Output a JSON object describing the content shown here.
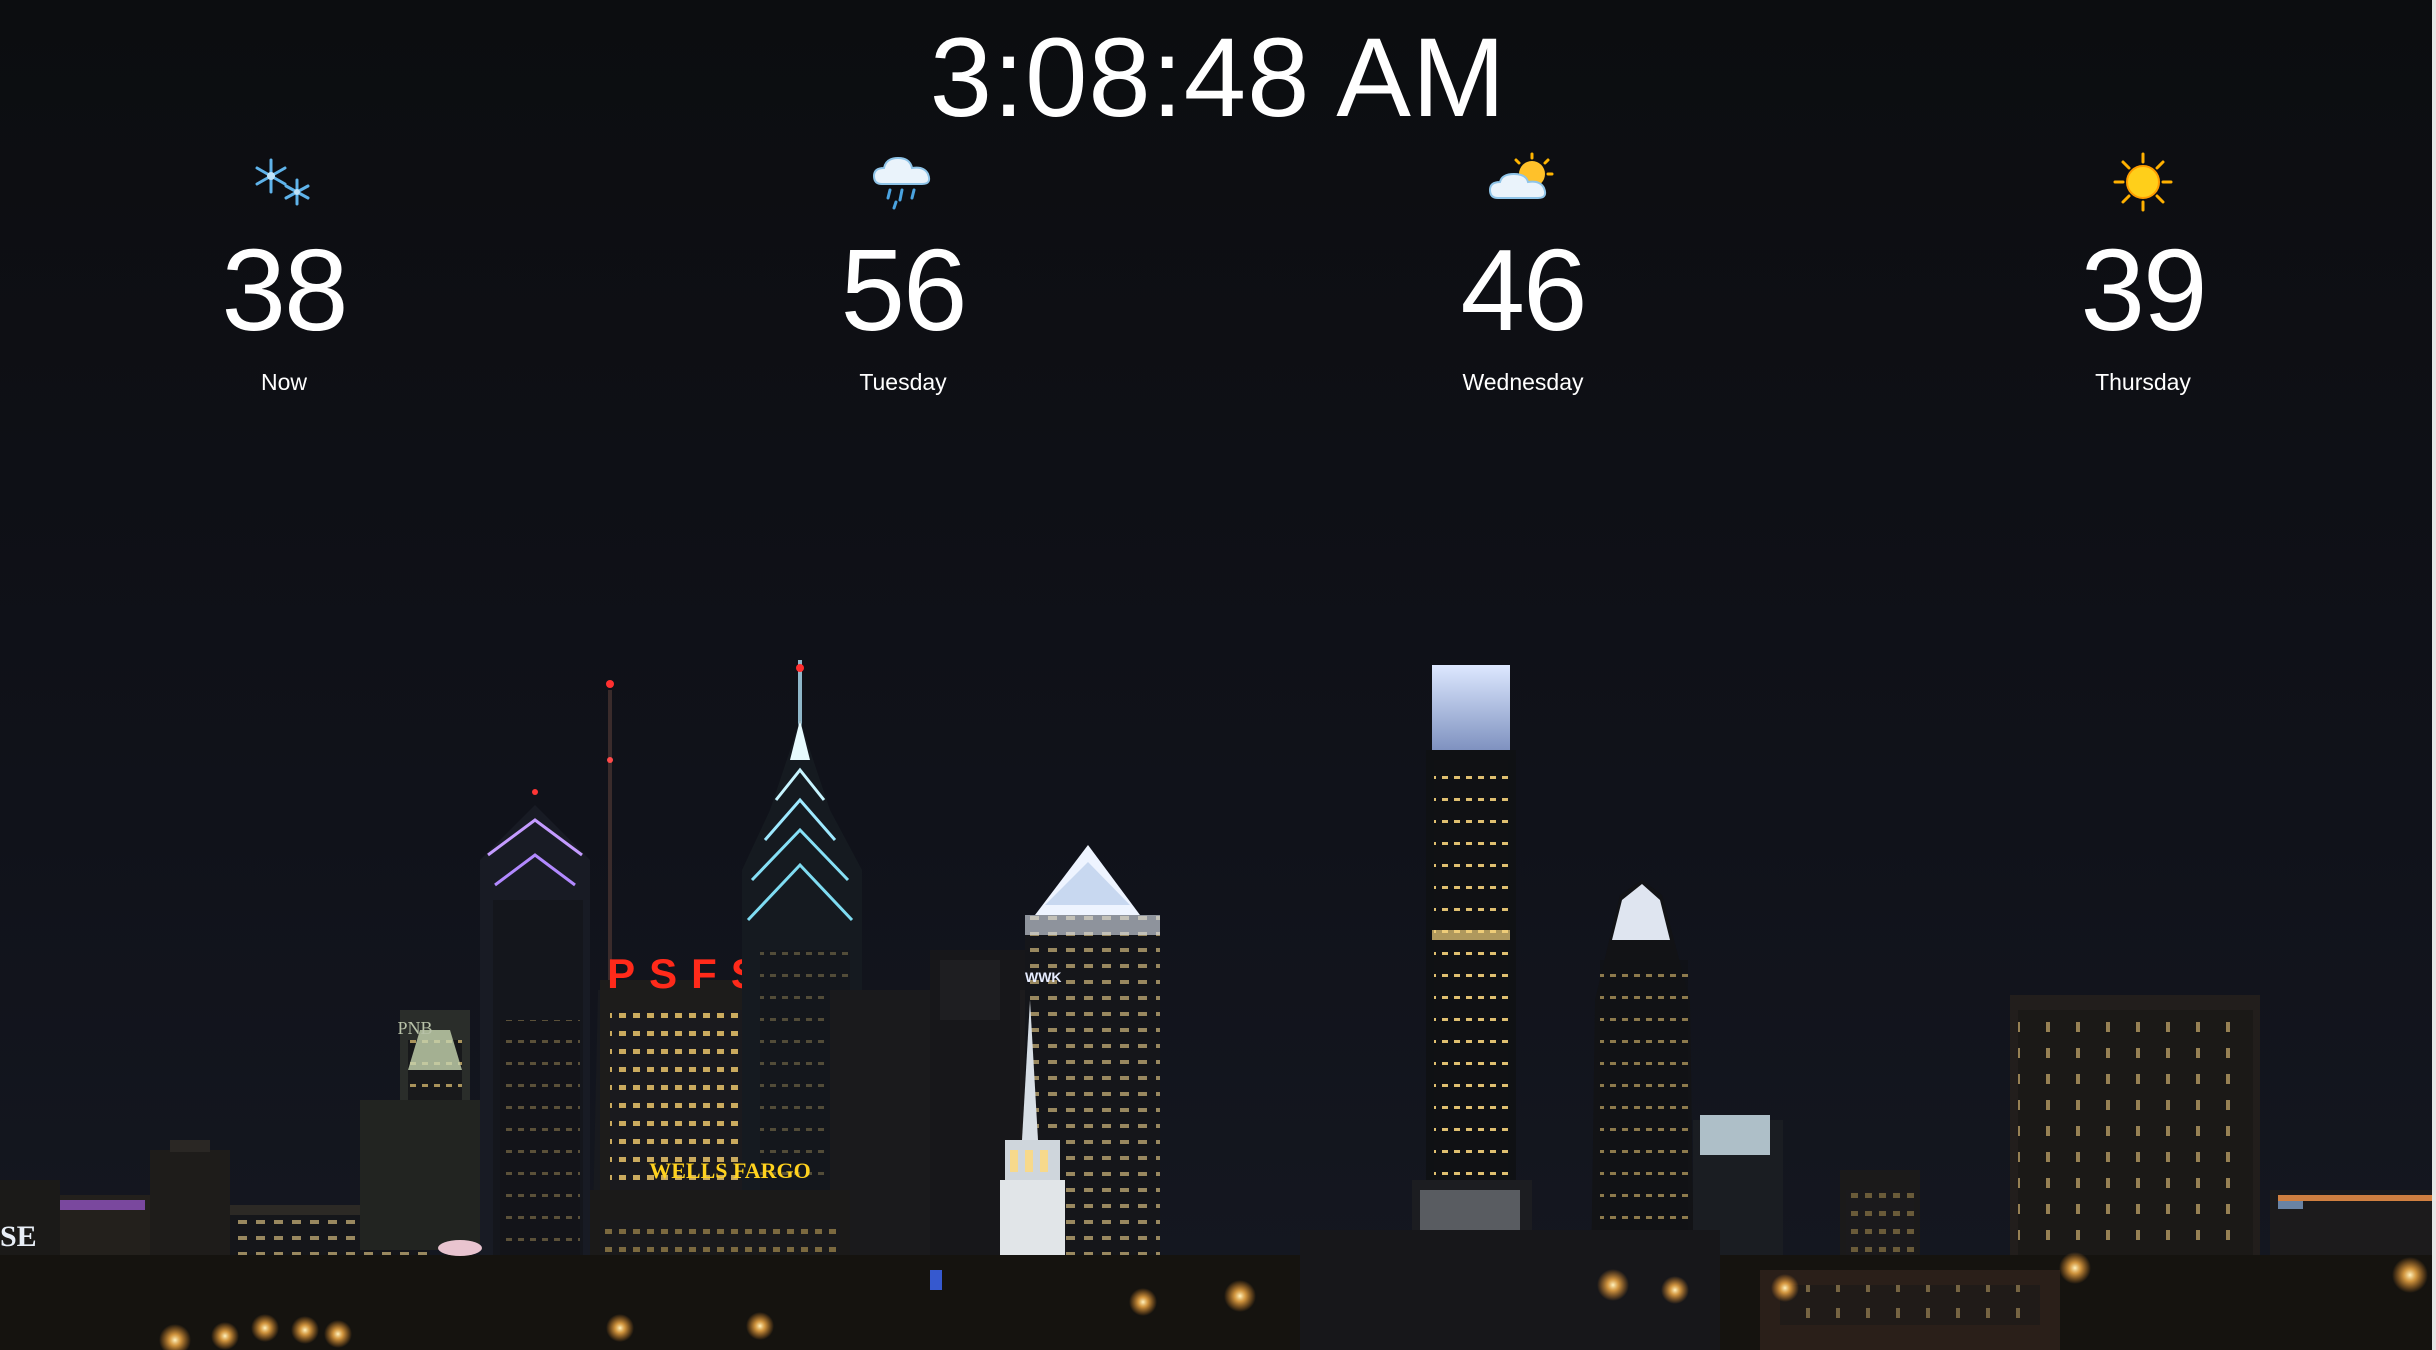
{
  "clock": {
    "time": "3:08:48 AM"
  },
  "forecast": [
    {
      "label": "Now",
      "temp": "38",
      "icon": "snowflake-icon"
    },
    {
      "label": "Tuesday",
      "temp": "56",
      "icon": "rain-cloud-icon"
    },
    {
      "label": "Wednesday",
      "temp": "46",
      "icon": "partly-cloudy-icon"
    },
    {
      "label": "Thursday",
      "temp": "39",
      "icon": "sun-icon"
    }
  ],
  "skyline_signs": {
    "psfs": "PSFS",
    "wells_fargo": "WELLS FARGO",
    "pnb": "PNB",
    "edge_sign": "SE",
    "wwk": "WWK"
  },
  "colors": {
    "background": "#0d0e11",
    "text": "#ffffff",
    "psfs_sign": "#ff2a1a",
    "wells_fargo_sign": "#ffd21e",
    "icon_blue": "#5fb3ea",
    "icon_sun": "#ffb400"
  }
}
